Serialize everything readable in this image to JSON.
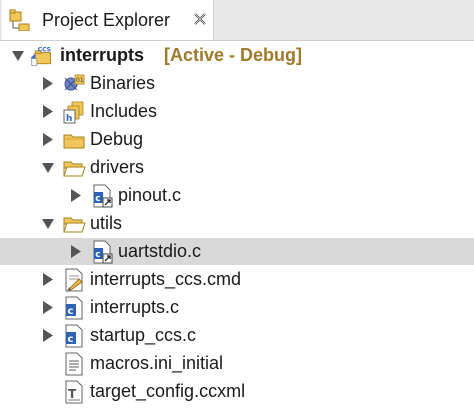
{
  "view": {
    "title": "Project Explorer",
    "close_icon": "close-x-icon"
  },
  "project": {
    "name": "interrupts",
    "decoration": "[Active - Debug]",
    "icon": "ccs-project-icon",
    "badge": "CCS",
    "decoration_color": "#a07a2c"
  },
  "tree": [
    {
      "label": "Binaries",
      "icon": "binaries-icon",
      "expanded": false
    },
    {
      "label": "Includes",
      "icon": "includes-icon",
      "expanded": false
    },
    {
      "label": "Debug",
      "icon": "folder-icon",
      "expanded": false
    },
    {
      "label": "drivers",
      "icon": "folder-open-icon",
      "expanded": true
    },
    {
      "label": "pinout.c",
      "icon": "c-source-link-icon",
      "expanded": false
    },
    {
      "label": "utils",
      "icon": "folder-open-icon",
      "expanded": true
    },
    {
      "label": "uartstdio.c",
      "icon": "c-source-link-icon",
      "expanded": false,
      "selected": true
    },
    {
      "label": "interrupts_ccs.cmd",
      "icon": "cmd-file-icon",
      "expanded": false
    },
    {
      "label": "interrupts.c",
      "icon": "c-source-icon",
      "expanded": false
    },
    {
      "label": "startup_ccs.c",
      "icon": "c-source-icon",
      "expanded": false
    },
    {
      "label": "macros.ini_initial",
      "icon": "text-file-icon"
    },
    {
      "label": "target_config.ccxml",
      "icon": "target-config-icon"
    }
  ],
  "colors": {
    "selection": "#d9d9d9",
    "folder": "#e7b84e",
    "c_icon_blue": "#2f63b8"
  }
}
